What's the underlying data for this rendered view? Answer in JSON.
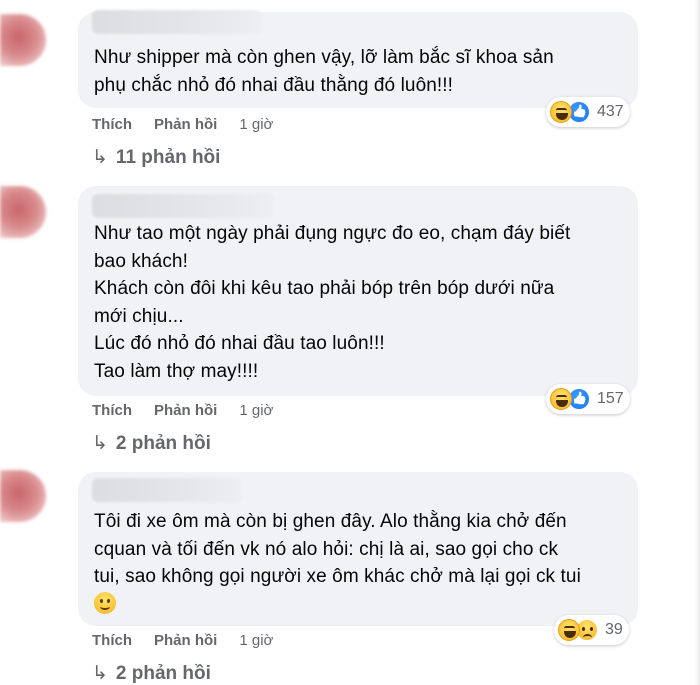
{
  "comments": [
    {
      "text_lines": [
        "Như shipper mà còn ghen vậy, lỡ làm bắc sĩ khoa sản",
        "phụ chắc nhỏ đó nhai đầu thằng đó luôn!!!"
      ],
      "reactions": [
        "haha-icon",
        "like-icon"
      ],
      "reaction_count": "437",
      "like_label": "Thích",
      "reply_label": "Phản hồi",
      "time": "1 giờ",
      "replies_label": "11 phản hồi"
    },
    {
      "text_lines": [
        "Như tao một ngày phải đụng ngực đo eo, chạm đáy biết",
        "bao khách!",
        "Khách còn đôi khi kêu tao phải bóp trên bóp dưới nữa",
        "mới chịu...",
        "Lúc đó nhỏ đó nhai đầu tao luôn!!!",
        "Tao làm thợ may!!!!"
      ],
      "reactions": [
        "haha-icon",
        "like-icon"
      ],
      "reaction_count": "157",
      "like_label": "Thích",
      "reply_label": "Phản hồi",
      "time": "1 giờ",
      "replies_label": "2 phản hồi"
    },
    {
      "text_lines": [
        "Tôi đi xe ôm mà còn bị ghen đây. Alo thằng kia chở đến",
        "cquan và tối đến vk nó alo hỏi: chị là ai, sao gọi cho ck",
        "tui, sao không gọi người xe ôm khác chở mà lại gọi ck tui"
      ],
      "reactions": [
        "haha-icon",
        "sad-icon"
      ],
      "reaction_count": "39",
      "like_label": "Thích",
      "reply_label": "Phản hồi",
      "time": "1 giờ",
      "replies_label": "2 phản hồi"
    }
  ],
  "reply_arrow": "↳"
}
